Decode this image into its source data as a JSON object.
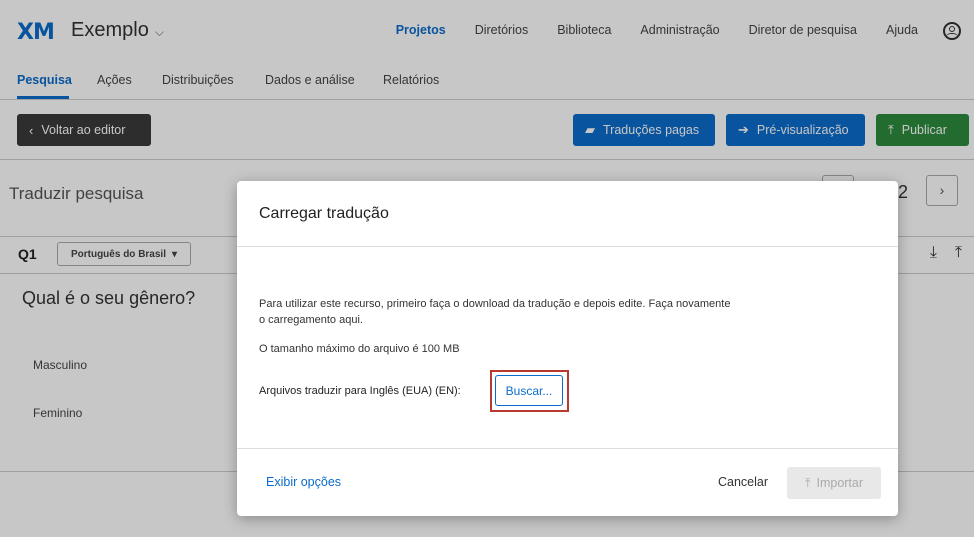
{
  "topnav": {
    "logo": "XM",
    "project": "Exemplo",
    "links": [
      "Projetos",
      "Diretórios",
      "Biblioteca",
      "Administração",
      "Diretor de pesquisa",
      "Ajuda"
    ]
  },
  "subnav": {
    "tabs": [
      "Pesquisa",
      "Ações",
      "Distribuições",
      "Dados e análise",
      "Relatórios"
    ]
  },
  "toolbar": {
    "back_label": "Voltar ao editor",
    "translations_label": "Traduções pagas",
    "preview_label": "Pré-visualização",
    "publish_label": "Publicar"
  },
  "content": {
    "title": "Traduzir pesquisa",
    "page_number": "2",
    "question_label": "Q1",
    "language": "Português do Brasil",
    "question_text": "Qual é o seu gênero?",
    "options": [
      "Masculino",
      "Feminino"
    ]
  },
  "modal": {
    "title": "Carregar tradução",
    "description": "Para utilizar este recurso, primeiro faça o download da tradução e depois edite. Faça novamente o carregamento aqui.",
    "max_size": "O tamanho máximo do arquivo é 100 MB",
    "files_label": "Arquivos traduzir para Inglês (EUA) (EN):",
    "browse_label": "Buscar...",
    "options_link": "Exibir opções",
    "cancel_label": "Cancelar",
    "import_label": "Importar"
  },
  "colors": {
    "accent": "#0b6ccb",
    "publish": "#2e8b3e",
    "highlight": "#b83a2e"
  }
}
